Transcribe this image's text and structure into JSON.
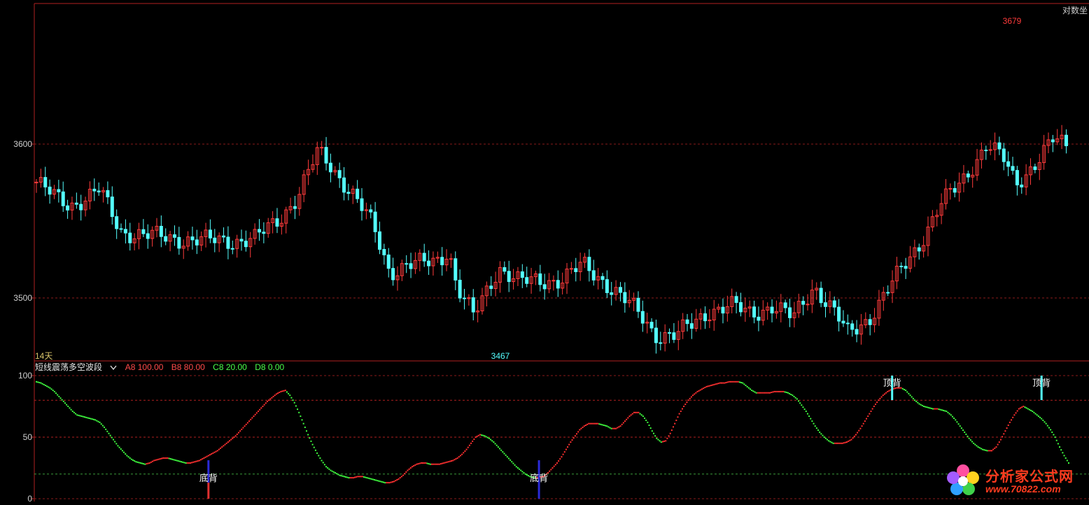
{
  "main_chart": {
    "top_right_label": "对数坐",
    "period_label": "14天",
    "y_ticks": [
      "3600",
      "3500"
    ],
    "y_tick_values": [
      3600,
      3500
    ],
    "high_label": "3679",
    "low_label": "3467",
    "colors": {
      "up": "#ff3b3b",
      "down": "#54ffff",
      "frame": "#b02020",
      "grid": "#8a1a1a"
    }
  },
  "indicator": {
    "name": "短线震荡多空波段",
    "dropdown_icon": "chevron-down-icon",
    "params": [
      {
        "text": "A8 100.00",
        "color": "#ff4a4a"
      },
      {
        "text": "B8 80.00",
        "color": "#ff4a4a"
      },
      {
        "text": "C8 20.00",
        "color": "#4aff4a"
      },
      {
        "text": "D8 0.00",
        "color": "#4aff4a"
      }
    ],
    "y_ticks": [
      "100",
      "50",
      "0"
    ],
    "signals": [
      "底背",
      "底背",
      "顶背",
      "顶背"
    ]
  },
  "chart_data": {
    "type": "line",
    "title": "",
    "xlabel": "",
    "ylabel": "",
    "ylim": [
      0,
      100
    ],
    "series": [
      {
        "values": [
          95,
          94,
          92,
          90,
          87,
          83,
          79,
          75,
          71,
          68,
          67,
          66,
          65,
          64,
          62,
          58,
          53,
          48,
          43,
          39,
          35,
          32,
          30,
          29,
          28,
          29,
          31,
          32,
          33,
          33,
          32,
          31,
          30,
          29,
          29,
          30,
          31,
          33,
          35,
          37,
          39,
          42,
          45,
          48,
          51,
          55,
          59,
          63,
          67,
          71,
          75,
          79,
          82,
          85,
          87,
          88,
          84,
          78,
          70,
          61,
          52,
          44,
          37,
          31,
          26,
          23,
          21,
          19,
          18,
          17,
          17,
          18,
          18,
          17,
          16,
          15,
          14,
          13,
          13,
          14,
          16,
          19,
          23,
          26,
          28,
          29,
          29,
          28,
          28,
          28,
          29,
          30,
          31,
          33,
          36,
          40,
          45,
          50,
          52,
          51,
          49,
          46,
          42,
          38,
          34,
          30,
          26,
          23,
          20,
          18,
          17,
          17,
          18,
          21,
          25,
          29,
          34,
          40,
          46,
          51,
          56,
          59,
          61,
          61,
          61,
          60,
          59,
          57,
          57,
          59,
          63,
          67,
          70,
          70,
          67,
          62,
          55,
          49,
          46,
          47,
          53,
          61,
          69,
          75,
          80,
          84,
          87,
          89,
          91,
          92,
          93,
          94,
          94,
          95,
          95,
          95,
          94,
          91,
          88,
          86,
          86,
          86,
          86,
          87,
          87,
          87,
          86,
          84,
          81,
          76,
          71,
          65,
          59,
          54,
          50,
          47,
          45,
          45,
          45,
          46,
          48,
          52,
          57,
          63,
          69,
          75,
          80,
          84,
          87,
          89,
          90,
          90,
          88,
          84,
          80,
          77,
          75,
          74,
          73,
          73,
          72,
          71,
          68,
          64,
          59,
          54,
          49,
          45,
          42,
          40,
          39,
          39,
          42,
          48,
          55,
          62,
          68,
          73,
          75,
          73,
          71,
          68,
          65,
          61,
          56,
          50,
          42,
          35,
          29
        ]
      }
    ],
    "signal_markers": [
      {
        "label": "底背",
        "index": 38
      },
      {
        "label": "底背",
        "index": 111
      },
      {
        "label": "顶背",
        "index": 189
      },
      {
        "label": "顶背",
        "index": 222
      }
    ]
  },
  "watermark": {
    "title": "分析家公式网",
    "url": "www.70822.com"
  }
}
